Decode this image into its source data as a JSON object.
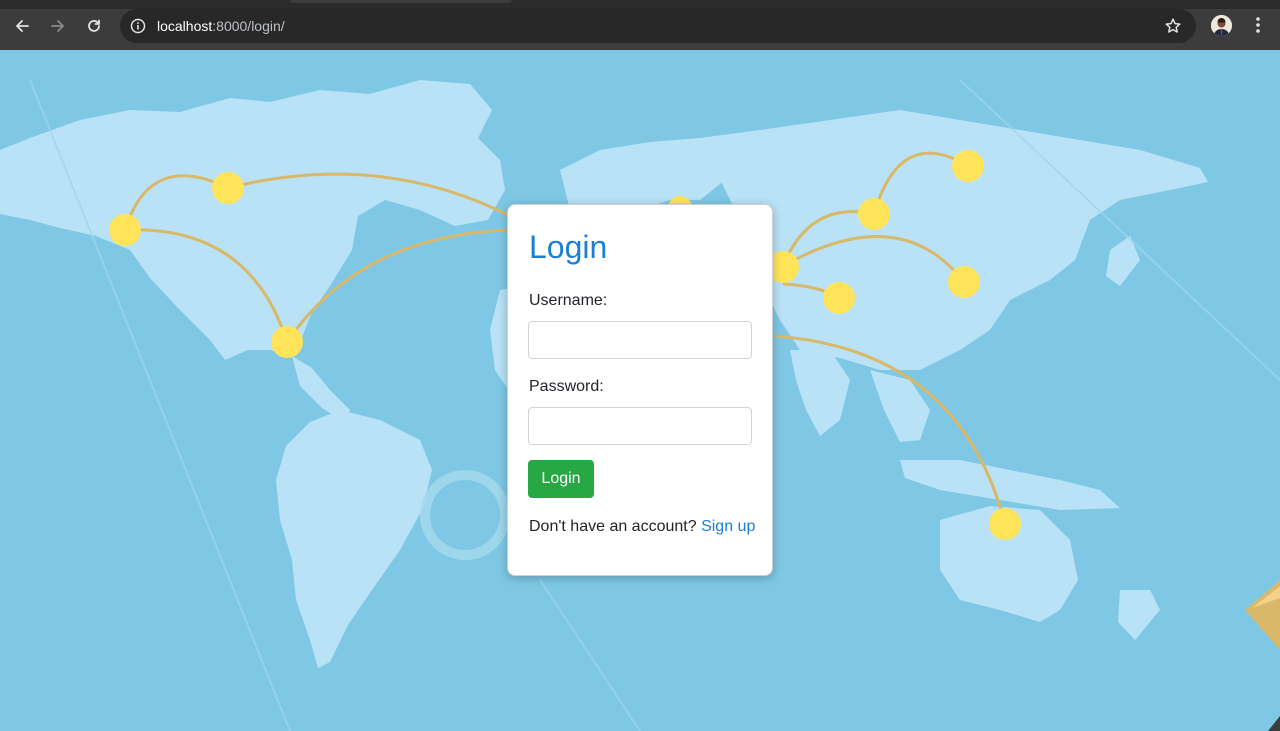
{
  "browser": {
    "url_host": "localhost",
    "url_rest": ":8000/login/",
    "icons": {
      "back": "arrow-left-icon",
      "forward": "arrow-right-icon",
      "reload": "reload-icon",
      "site_info": "info-icon",
      "bookmark": "star-icon",
      "menu": "kebab-menu-icon"
    }
  },
  "login": {
    "title": "Login",
    "username_label": "Username:",
    "username_value": "",
    "password_label": "Password:",
    "password_value": "",
    "submit_label": "Login",
    "signup_prompt": "Don't have an account?",
    "signup_link": "Sign up"
  },
  "colors": {
    "background": "#7ec8e6",
    "land": "#b9e2f6",
    "node": "#ffe45a",
    "route": "#d9b86a",
    "title": "#1c7fd6",
    "button": "#28a745"
  }
}
